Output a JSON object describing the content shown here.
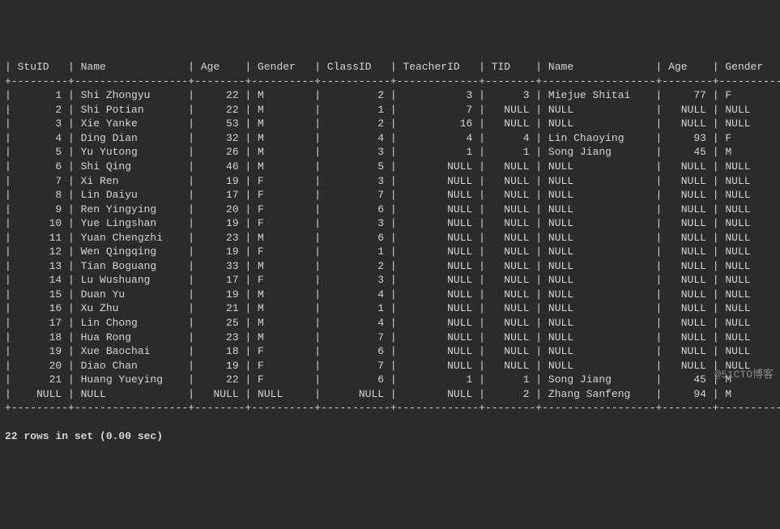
{
  "columns": [
    "StuID",
    "Name",
    "Age",
    "Gender",
    "ClassID",
    "TeacherID",
    "TID",
    "Name",
    "Age",
    "Gender"
  ],
  "widths": [
    7,
    16,
    6,
    8,
    9,
    11,
    6,
    16,
    6,
    8
  ],
  "align": [
    "r",
    "l",
    "r",
    "l",
    "r",
    "r",
    "r",
    "l",
    "r",
    "l"
  ],
  "rows": [
    [
      "1",
      "Shi Zhongyu",
      "22",
      "M",
      "2",
      "3",
      "3",
      "Miejue Shitai",
      "77",
      "F"
    ],
    [
      "2",
      "Shi Potian",
      "22",
      "M",
      "1",
      "7",
      "NULL",
      "NULL",
      "NULL",
      "NULL"
    ],
    [
      "3",
      "Xie Yanke",
      "53",
      "M",
      "2",
      "16",
      "NULL",
      "NULL",
      "NULL",
      "NULL"
    ],
    [
      "4",
      "Ding Dian",
      "32",
      "M",
      "4",
      "4",
      "4",
      "Lin Chaoying",
      "93",
      "F"
    ],
    [
      "5",
      "Yu Yutong",
      "26",
      "M",
      "3",
      "1",
      "1",
      "Song Jiang",
      "45",
      "M"
    ],
    [
      "6",
      "Shi Qing",
      "46",
      "M",
      "5",
      "NULL",
      "NULL",
      "NULL",
      "NULL",
      "NULL"
    ],
    [
      "7",
      "Xi Ren",
      "19",
      "F",
      "3",
      "NULL",
      "NULL",
      "NULL",
      "NULL",
      "NULL"
    ],
    [
      "8",
      "Lin Daiyu",
      "17",
      "F",
      "7",
      "NULL",
      "NULL",
      "NULL",
      "NULL",
      "NULL"
    ],
    [
      "9",
      "Ren Yingying",
      "20",
      "F",
      "6",
      "NULL",
      "NULL",
      "NULL",
      "NULL",
      "NULL"
    ],
    [
      "10",
      "Yue Lingshan",
      "19",
      "F",
      "3",
      "NULL",
      "NULL",
      "NULL",
      "NULL",
      "NULL"
    ],
    [
      "11",
      "Yuan Chengzhi",
      "23",
      "M",
      "6",
      "NULL",
      "NULL",
      "NULL",
      "NULL",
      "NULL"
    ],
    [
      "12",
      "Wen Qingqing",
      "19",
      "F",
      "1",
      "NULL",
      "NULL",
      "NULL",
      "NULL",
      "NULL"
    ],
    [
      "13",
      "Tian Boguang",
      "33",
      "M",
      "2",
      "NULL",
      "NULL",
      "NULL",
      "NULL",
      "NULL"
    ],
    [
      "14",
      "Lu Wushuang",
      "17",
      "F",
      "3",
      "NULL",
      "NULL",
      "NULL",
      "NULL",
      "NULL"
    ],
    [
      "15",
      "Duan Yu",
      "19",
      "M",
      "4",
      "NULL",
      "NULL",
      "NULL",
      "NULL",
      "NULL"
    ],
    [
      "16",
      "Xu Zhu",
      "21",
      "M",
      "1",
      "NULL",
      "NULL",
      "NULL",
      "NULL",
      "NULL"
    ],
    [
      "17",
      "Lin Chong",
      "25",
      "M",
      "4",
      "NULL",
      "NULL",
      "NULL",
      "NULL",
      "NULL"
    ],
    [
      "18",
      "Hua Rong",
      "23",
      "M",
      "7",
      "NULL",
      "NULL",
      "NULL",
      "NULL",
      "NULL"
    ],
    [
      "19",
      "Xue Baochai",
      "18",
      "F",
      "6",
      "NULL",
      "NULL",
      "NULL",
      "NULL",
      "NULL"
    ],
    [
      "20",
      "Diao Chan",
      "19",
      "F",
      "7",
      "NULL",
      "NULL",
      "NULL",
      "NULL",
      "NULL"
    ],
    [
      "21",
      "Huang Yueying",
      "22",
      "F",
      "6",
      "1",
      "1",
      "Song Jiang",
      "45",
      "M"
    ],
    [
      "NULL",
      "NULL",
      "NULL",
      "NULL",
      "NULL",
      "NULL",
      "2",
      "Zhang Sanfeng",
      "94",
      "M"
    ]
  ],
  "footer": "22 rows in set (0.00 sec)",
  "watermark": "@51CTO博客"
}
